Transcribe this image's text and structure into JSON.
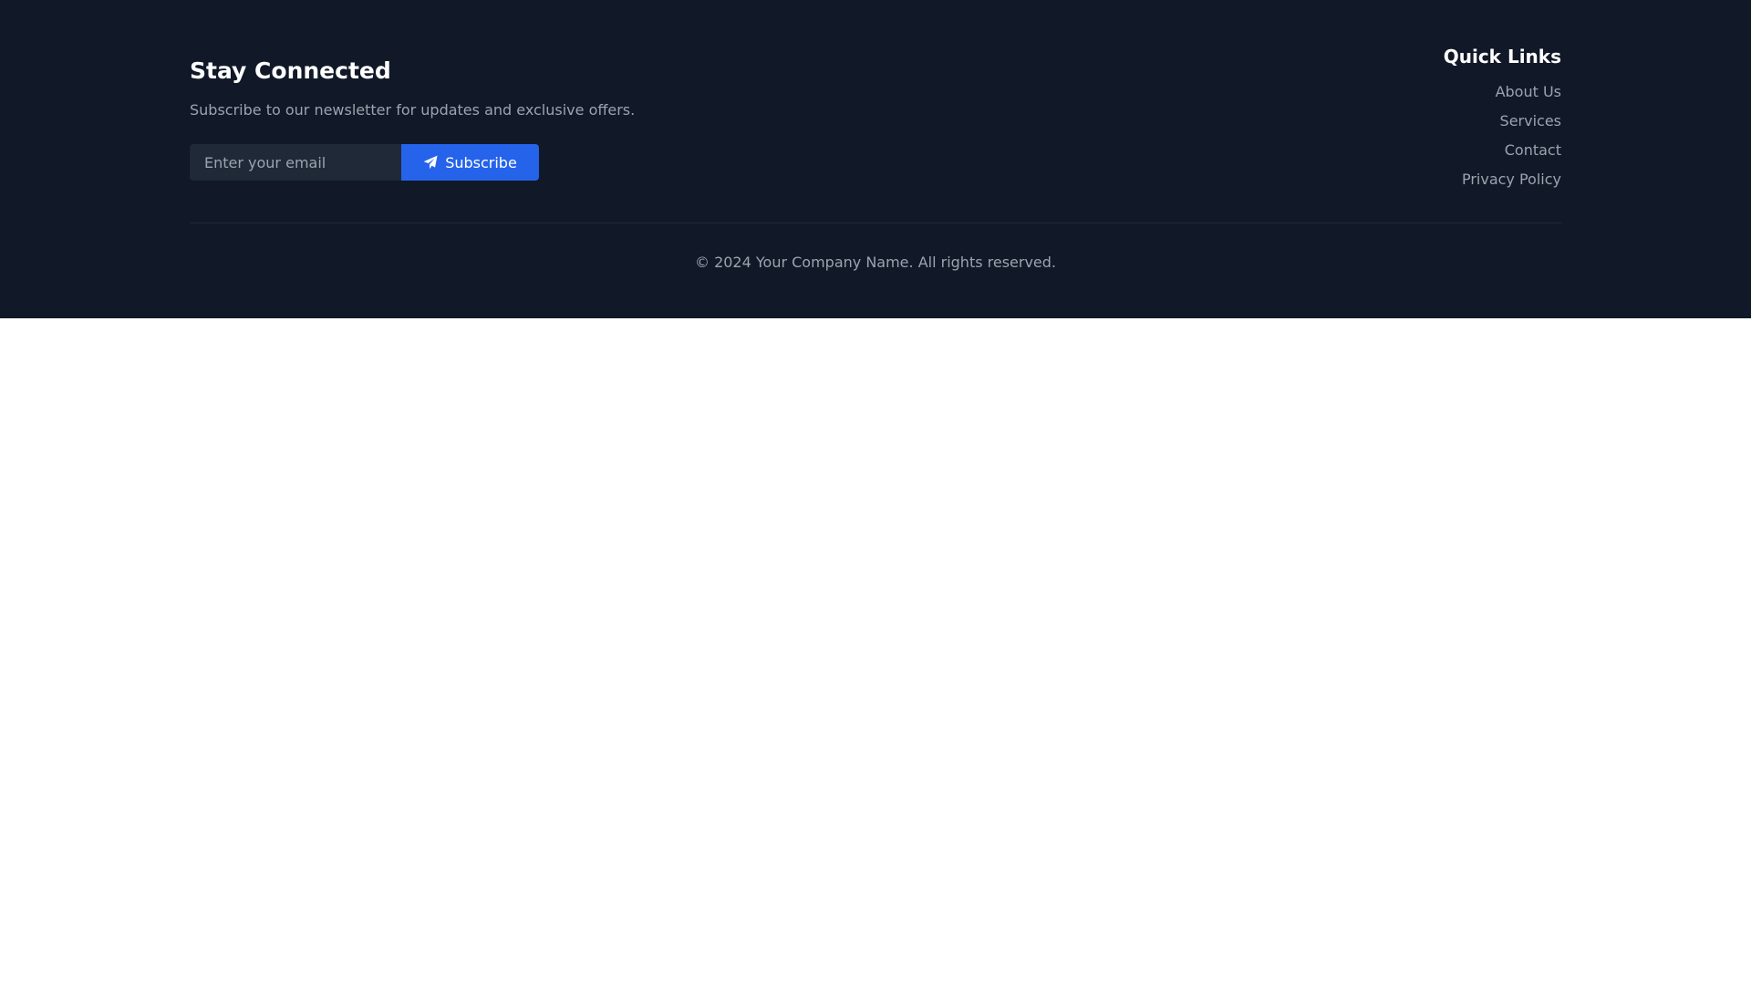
{
  "colors": {
    "footer_bg": "#111827",
    "input_bg": "#1f2937",
    "accent": "#2563eb",
    "muted_text": "#9ca3af",
    "heading_text": "#ffffff"
  },
  "newsletter": {
    "title": "Stay Connected",
    "description": "Subscribe to our newsletter for updates and exclusive offers.",
    "email_placeholder": "Enter your email",
    "email_value": "",
    "subscribe_label": "Subscribe",
    "subscribe_icon": "paper-plane-icon"
  },
  "quick_links": {
    "title": "Quick Links",
    "items": [
      {
        "label": "About Us"
      },
      {
        "label": "Services"
      },
      {
        "label": "Contact"
      },
      {
        "label": "Privacy Policy"
      }
    ]
  },
  "copyright": "© 2024 Your Company Name. All rights reserved."
}
